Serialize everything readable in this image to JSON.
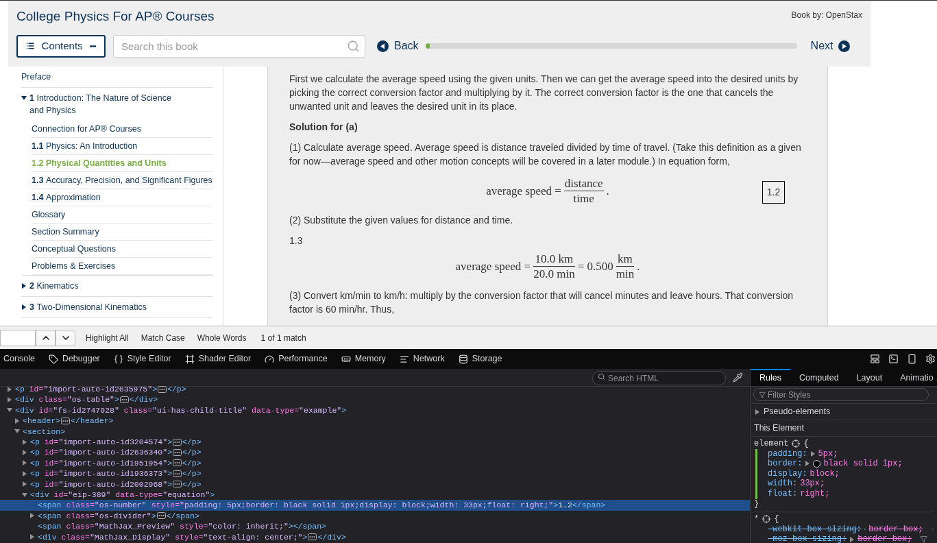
{
  "header": {
    "title": "College Physics For AP® Courses",
    "author": "Book by: OpenStax"
  },
  "toolbar": {
    "contents_label": "Contents",
    "search": {
      "placeholder": "Search this book"
    },
    "back": "Back",
    "next": "Next",
    "progress": {
      "level": 0.01
    }
  },
  "toc": [
    {
      "title": "Preface",
      "selected": false
    },
    {
      "number": "1",
      "title": "Introduction: The Nature of Science and Physics",
      "selected": false,
      "expanded": true,
      "children": [
        {
          "title": "Connection for AP® Courses",
          "selected": false
        },
        {
          "number": "1.1",
          "title": "Physics: An Introduction",
          "selected": false
        },
        {
          "number": "1.2",
          "title": "Physical Quantities and Units",
          "selected": true
        },
        {
          "number": "1.3",
          "title": "Accuracy, Precision, and Significant Figures",
          "selected": false
        },
        {
          "number": "1.4",
          "title": "Approximation",
          "selected": false
        },
        {
          "title": "Glossary",
          "selected": false
        },
        {
          "title": "Section Summary",
          "selected": false
        },
        {
          "title": "Conceptual Questions",
          "selected": false
        },
        {
          "title": "Problems & Exercises",
          "selected": false
        }
      ]
    },
    {
      "number": "2",
      "title": "Kinematics",
      "selected": false,
      "expanded": false
    },
    {
      "number": "3",
      "title": "Two-Dimensional Kinematics",
      "selected": false,
      "expanded": false
    }
  ],
  "content": [
    {
      "kind": "paragraph",
      "text": "First we calculate the average speed using the given units. Then we can get the average speed into the desired units by picking the correct conversion factor and multiplying by it. The correct conversion factor is the one that cancels the unwanted unit and leaves the desired unit in its place."
    },
    {
      "kind": "heading",
      "text": "Solution for (a)"
    },
    {
      "kind": "paragraph",
      "text": "(1) Calculate average speed. Average speed is distance traveled divided by time of travel. (Take this definition as a given for now—average speed and other motion concepts will be covered in a later module.) In equation form,"
    },
    {
      "kind": "equation",
      "number": "1.2",
      "parts": [
        {
          "kind": "text",
          "text": "average speed ="
        },
        {
          "kind": "fraction",
          "num": "distance",
          "den": "time"
        },
        {
          "kind": "text",
          "text": "."
        }
      ]
    },
    {
      "kind": "paragraph",
      "text": "(2) Substitute the given values for distance and time."
    },
    {
      "kind": "label",
      "text": "1.3"
    },
    {
      "kind": "equation",
      "parts": [
        {
          "kind": "text",
          "text": "average speed ="
        },
        {
          "kind": "fraction",
          "num": "10.0 km",
          "den": "20.0 min"
        },
        {
          "kind": "text",
          "text": "= 0.500"
        },
        {
          "kind": "fraction",
          "num": "km",
          "den": "min"
        },
        {
          "kind": "text",
          "text": "."
        }
      ]
    },
    {
      "kind": "paragraph",
      "text": "(3) Convert km/min to km/h: multiply by the conversion factor that will cancel minutes and leave hours. That conversion factor is 60 min/hr. Thus,"
    }
  ],
  "find_bar": {
    "options": [
      "Highlight All",
      "Match Case",
      "Whole Words"
    ],
    "result": "1 of 1 match"
  },
  "devtools": {
    "tools": [
      {
        "label": "Console"
      },
      {
        "label": "Debugger"
      },
      {
        "label": "Style Editor"
      },
      {
        "label": "Shader Editor"
      },
      {
        "label": "Performance"
      },
      {
        "label": "Memory"
      },
      {
        "label": "Network"
      },
      {
        "label": "Storage"
      }
    ],
    "markup": {
      "search": {
        "placeholder": "Search HTML"
      },
      "nodes": [
        {
          "kind": "collapsed",
          "open": "<p id=\"import-auto-id2635975\">",
          "close": "</p>",
          "selected": false
        },
        {
          "kind": "collapsed",
          "open": "<div class=\"os-table\">",
          "close": "</div>",
          "selected": false
        },
        {
          "kind": "expanded",
          "open": "<div id=\"fs-id2747928\" class=\"ui-has-child-title\" data-type=\"example\">",
          "selected": false,
          "children": [
            {
              "kind": "collapsed",
              "open": "<header>",
              "close": "</header>",
              "selected": false
            },
            {
              "kind": "expanded",
              "open": "<section>",
              "selected": false,
              "children": [
                {
                  "kind": "collapsed",
                  "open": "<p id=\"import-auto-id3204574\">",
                  "close": "</p>",
                  "selected": false
                },
                {
                  "kind": "collapsed",
                  "open": "<p id=\"import-auto-id2636340\">",
                  "close": "</p>",
                  "selected": false
                },
                {
                  "kind": "collapsed",
                  "open": "<p id=\"import-auto-id1951954\">",
                  "close": "</p>",
                  "selected": false
                },
                {
                  "kind": "collapsed",
                  "open": "<p id=\"import-auto-id1936373\">",
                  "close": "</p>",
                  "selected": false
                },
                {
                  "kind": "collapsed",
                  "open": "<p id=\"import-auto-id2002968\">",
                  "close": "</p>",
                  "selected": false
                },
                {
                  "kind": "expanded",
                  "open": "<div id=\"eip-389\" data-type=\"equation\">",
                  "selected": false,
                  "children": [
                    {
                      "kind": "leaf",
                      "open": "<span class=\"os-number\" style=\"padding: 5px;border: black solid 1px;display: block;width: 33px;float: right;\">",
                      "text": "1.2",
                      "close": "</span>",
                      "selected": true
                    },
                    {
                      "kind": "collapsed",
                      "open": "<span class=\"os-divider\">",
                      "close": "</span>",
                      "selected": false
                    },
                    {
                      "kind": "leaf",
                      "open": "<span class=\"MathJax_Preview\" style=\"color: inherit;\">",
                      "close": "</span>",
                      "selected": false
                    },
                    {
                      "kind": "collapsed",
                      "open": "<div class=\"MathJax_Display\" style=\"text-align: center;\">",
                      "close": "</div>",
                      "selected": false
                    }
                  ]
                }
              ]
            }
          ]
        }
      ]
    },
    "sidebar": {
      "tabs": [
        {
          "label": "Rules",
          "selected": true
        },
        {
          "label": "Computed",
          "selected": false
        },
        {
          "label": "Layout",
          "selected": false
        },
        {
          "label": "Animatio",
          "selected": false
        }
      ],
      "filter": {
        "placeholder": "Filter Styles"
      },
      "pseudo_elements": "Pseudo-elements",
      "section_title": "This Element",
      "rules": [
        {
          "selector": "element",
          "open_brace": "{",
          "close_brace": "}",
          "changed": true,
          "declarations": [
            {
              "property": "padding:",
              "value": "5px;",
              "expandable": true,
              "overridden": false
            },
            {
              "property": "border:",
              "value": "black solid 1px;",
              "expandable": true,
              "overridden": false,
              "color": "#000000"
            },
            {
              "property": "display:",
              "value": "block;",
              "expandable": false,
              "overridden": false
            },
            {
              "property": "width:",
              "value": "33px;",
              "expandable": false,
              "overridden": false
            },
            {
              "property": "float:",
              "value": "right;",
              "expandable": false,
              "overridden": false
            }
          ]
        },
        {
          "selector": "*",
          "open_brace": "{",
          "changed": false,
          "declarations": [
            {
              "property": "-webkit-box-sizing:",
              "value": "border-box;",
              "expandable": true,
              "overridden": true
            },
            {
              "property": "-moz-box-sizing:",
              "value": "border-box;",
              "expandable": true,
              "overridden": true
            }
          ]
        }
      ]
    }
  }
}
